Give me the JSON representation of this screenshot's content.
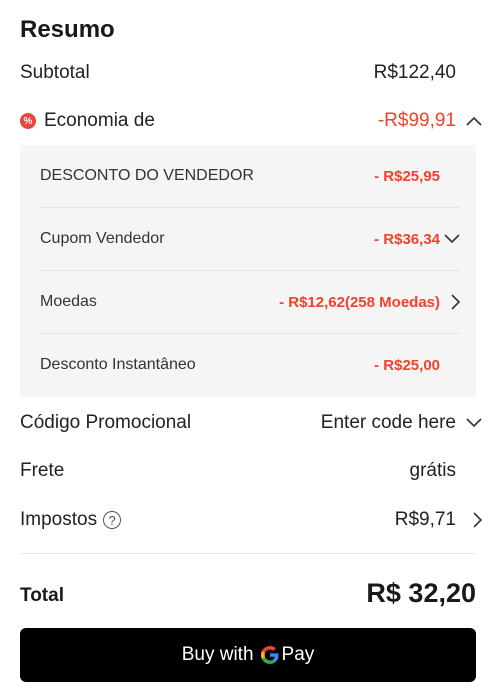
{
  "summary": {
    "title": "Resumo",
    "subtotal_label": "Subtotal",
    "subtotal_value": "R$122,40",
    "savings_label": "Economia de",
    "savings_value": "-R$99,91",
    "discounts": [
      {
        "label": "DESCONTO DO VENDEDOR",
        "value": "- R$25,95"
      },
      {
        "label": "Cupom Vendedor",
        "value": "- R$36,34"
      },
      {
        "label": "Moedas",
        "value": "- R$12,62(258 Moedas)"
      },
      {
        "label": "Desconto Instantâneo",
        "value": "- R$25,00"
      }
    ],
    "promo_label": "Código Promocional",
    "promo_value": "Enter code here",
    "shipping_label": "Frete",
    "shipping_value": "grátis",
    "tax_label": "Impostos",
    "tax_value": "R$9,71",
    "total_label": "Total",
    "total_value": "R$ 32,20"
  },
  "pay_button": {
    "prefix": "Buy with",
    "suffix": "Pay"
  },
  "colors": {
    "discount_red": "#f4402c",
    "button_bg": "#000000",
    "panel_bg": "#f5f5f5"
  }
}
